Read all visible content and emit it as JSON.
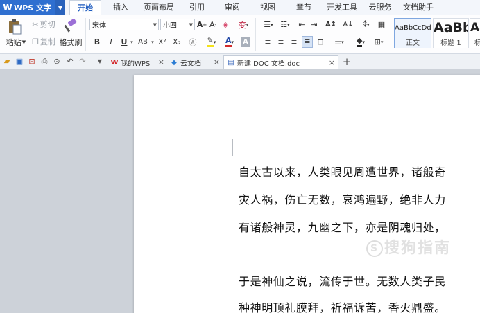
{
  "app": {
    "name": "WPS 文字",
    "logo": "W"
  },
  "menu": {
    "tabs": [
      {
        "label": "开始",
        "active": true
      },
      {
        "label": "插入"
      },
      {
        "label": "页面布局"
      },
      {
        "label": "引用"
      },
      {
        "label": "审阅"
      },
      {
        "label": "视图"
      },
      {
        "label": "章节"
      },
      {
        "label": "开发工具"
      },
      {
        "label": "云服务"
      },
      {
        "label": "文档助手"
      }
    ]
  },
  "ribbon": {
    "paste": "粘贴",
    "cut": "剪切",
    "copy": "复制",
    "format_painter": "格式刷",
    "font_name": "宋体",
    "font_size": "小四",
    "bold": "B",
    "italic": "I",
    "underline": "U",
    "strikethrough": "AB",
    "superscript": "X²",
    "subscript": "X₂",
    "styles": [
      {
        "sample": "AaBbCcDd",
        "name": "正文"
      },
      {
        "sample": "AaBb",
        "name": "标题 1"
      },
      {
        "sample": "Aa",
        "name": "标"
      }
    ]
  },
  "tabs": [
    {
      "label": "我的WPS",
      "icon": "wps-logo-icon"
    },
    {
      "label": "云文档",
      "icon": "cloud-doc-icon"
    },
    {
      "label": "新建 DOC 文档.doc",
      "icon": "doc-file-icon",
      "active": true
    }
  ],
  "document": {
    "lines": [
      "自太古以来，人类眼见周遭世界，诸般奇",
      "灾人祸，伤亡无数，哀鸿遍野，绝非人力",
      "有诸般神灵，九幽之下，亦是阴魂归处，",
      "于是神仙之说，流传于世。无数人类子民",
      "种神明顶礼膜拜，祈福诉苦，香火鼎盛。"
    ]
  },
  "watermark": {
    "text": "搜狗指南",
    "logo": "S"
  },
  "colors": {
    "accent": "#2f6fd0",
    "active_tab_text": "#1d5bbf",
    "doc_bg": "#cdd2d9"
  }
}
